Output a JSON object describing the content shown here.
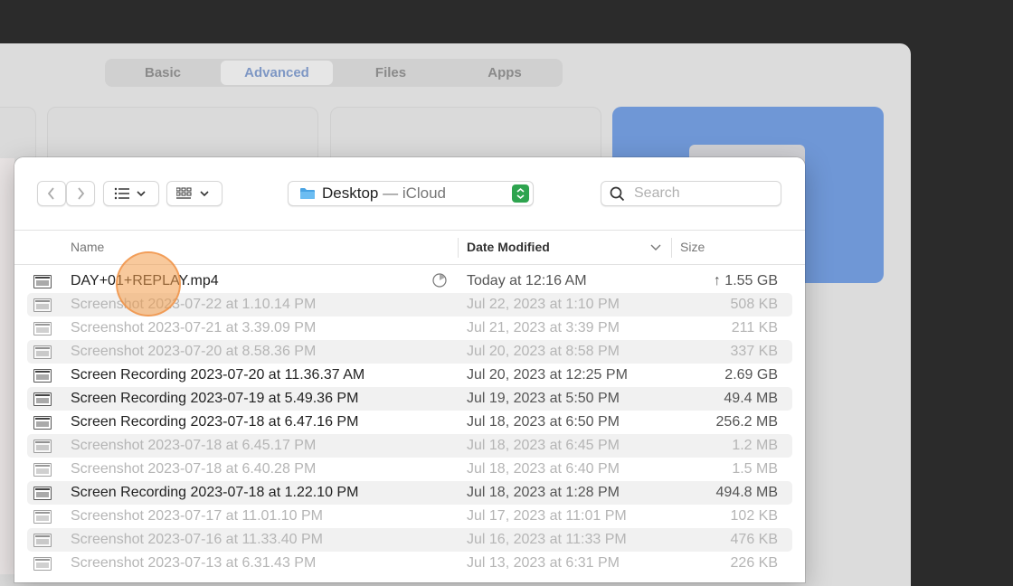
{
  "settings_tabs": [
    {
      "label": "Basic",
      "active": false
    },
    {
      "label": "Advanced",
      "active": true
    },
    {
      "label": "Files",
      "active": false
    },
    {
      "label": "Apps",
      "active": false
    }
  ],
  "toolbar": {
    "back_icon": "chevron-left-icon",
    "forward_icon": "chevron-right-icon",
    "list_view_icon": "list-icon",
    "group_icon": "grid-icon",
    "location_name": "Desktop",
    "location_sub": " — iCloud",
    "search_placeholder": "Search"
  },
  "columns": {
    "name": "Name",
    "date": "Date Modified",
    "size": "Size"
  },
  "files": [
    {
      "name": "DAY+01+REPLAY.mp4",
      "date": "Today at 12:16 AM",
      "size": "↑ 1.55 GB",
      "enabled": true,
      "syncing": true
    },
    {
      "name": "Screenshot 2023-07-22 at 1.10.14 PM",
      "date": "Jul 22, 2023 at 1:10 PM",
      "size": "508 KB",
      "enabled": false
    },
    {
      "name": "Screenshot 2023-07-21 at 3.39.09 PM",
      "date": "Jul 21, 2023 at 3:39 PM",
      "size": "211 KB",
      "enabled": false
    },
    {
      "name": "Screenshot 2023-07-20 at 8.58.36 PM",
      "date": "Jul 20, 2023 at 8:58 PM",
      "size": "337 KB",
      "enabled": false
    },
    {
      "name": "Screen Recording 2023-07-20 at 11.36.37 AM",
      "date": "Jul 20, 2023 at 12:25 PM",
      "size": "2.69 GB",
      "enabled": true
    },
    {
      "name": "Screen Recording 2023-07-19 at 5.49.36 PM",
      "date": "Jul 19, 2023 at 5:50 PM",
      "size": "49.4 MB",
      "enabled": true
    },
    {
      "name": "Screen Recording 2023-07-18 at 6.47.16 PM",
      "date": "Jul 18, 2023 at 6:50 PM",
      "size": "256.2 MB",
      "enabled": true
    },
    {
      "name": "Screenshot 2023-07-18 at 6.45.17 PM",
      "date": "Jul 18, 2023 at 6:45 PM",
      "size": "1.2 MB",
      "enabled": false
    },
    {
      "name": "Screenshot 2023-07-18 at 6.40.28 PM",
      "date": "Jul 18, 2023 at 6:40 PM",
      "size": "1.5 MB",
      "enabled": false
    },
    {
      "name": "Screen Recording 2023-07-18 at 1.22.10 PM",
      "date": "Jul 18, 2023 at 1:28 PM",
      "size": "494.8 MB",
      "enabled": true
    },
    {
      "name": "Screenshot 2023-07-17 at 11.01.10 PM",
      "date": "Jul 17, 2023 at 11:01 PM",
      "size": "102 KB",
      "enabled": false
    },
    {
      "name": "Screenshot 2023-07-16 at 11.33.40 PM",
      "date": "Jul 16, 2023 at 11:33 PM",
      "size": "476 KB",
      "enabled": false
    },
    {
      "name": "Screenshot 2023-07-13 at 6.31.43 PM",
      "date": "Jul 13, 2023 at 6:31 PM",
      "size": "226 KB",
      "enabled": false
    }
  ],
  "colors": {
    "active_tab_text": "#7e97c4",
    "highlight_card": "#6f97d6",
    "stepper_green": "#2ea44f",
    "cursor_highlight": "#f39c4b"
  }
}
